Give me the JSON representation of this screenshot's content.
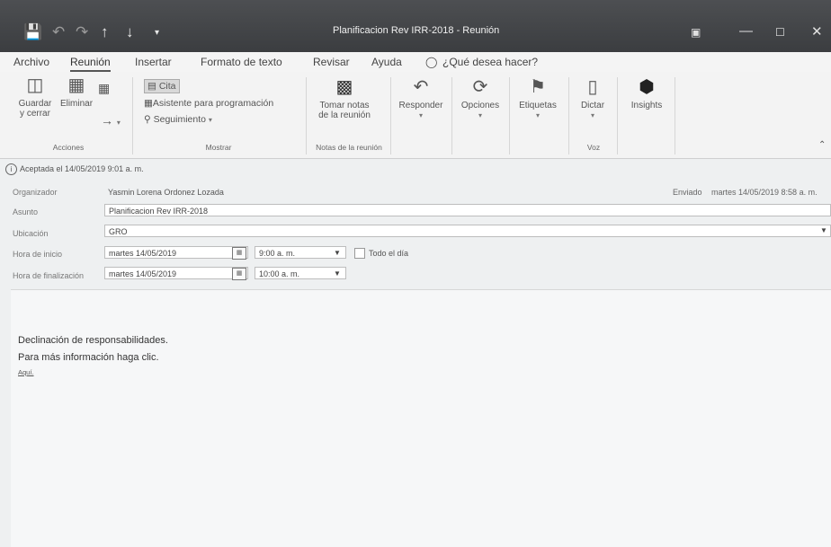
{
  "window": {
    "title": "Planificacion Rev IRR-2018  -  Reunión",
    "quick_access": [
      "save-icon",
      "undo-icon",
      "redo-icon",
      "up-arrow-icon",
      "down-arrow-icon",
      "more-icon"
    ],
    "controls": [
      "ribbon-display-icon",
      "minimize-icon",
      "maximize-icon",
      "close-icon"
    ]
  },
  "menu": {
    "archivo": "Archivo",
    "reunion": "Reunión",
    "insertar": "Insertar",
    "formato": "Formato de texto",
    "revisar": "Revisar",
    "ayuda": "Ayuda",
    "search": "¿Qué desea hacer?"
  },
  "ribbon": {
    "acciones": {
      "label": "Acciones",
      "guardar_1": "Guardar",
      "guardar_2": "y cerrar",
      "eliminar": "Eliminar"
    },
    "mostrar": {
      "label": "Mostrar",
      "cita": "Cita",
      "asistente": "Asistente para programación",
      "seguimiento": "Seguimiento"
    },
    "notas": {
      "label": "Notas de la reunión",
      "tomar_1": "Tomar notas",
      "tomar_2": "de la reunión"
    },
    "responder": "Responder",
    "opciones": "Opciones",
    "etiquetas": "Etiquetas",
    "voz": {
      "label": "Voz",
      "dictar": "Dictar"
    },
    "insights": "Insights"
  },
  "info": "Aceptada el 14/05/2019 9:01 a. m.",
  "form": {
    "organizador_label": "Organizador",
    "organizador": "Yasmin Lorena Ordonez Lozada",
    "enviado_label": "Enviado",
    "enviado": "martes 14/05/2019 8:58 a. m.",
    "asunto_label": "Asunto",
    "asunto": "Planificacion Rev IRR-2018",
    "ubicacion_label": "Ubicación",
    "ubicacion": "GRO",
    "inicio_label": "Hora de inicio",
    "inicio_fecha": "martes 14/05/2019",
    "inicio_hora": "9:00 a. m.",
    "todo_dia": "Todo el día",
    "fin_label": "Hora de finalización",
    "fin_fecha": "martes 14/05/2019",
    "fin_hora": "10:00 a. m."
  },
  "body": {
    "line1": "Declinación de responsabilidades.",
    "line2": "Para más información haga clic.",
    "link": "Aquí."
  }
}
